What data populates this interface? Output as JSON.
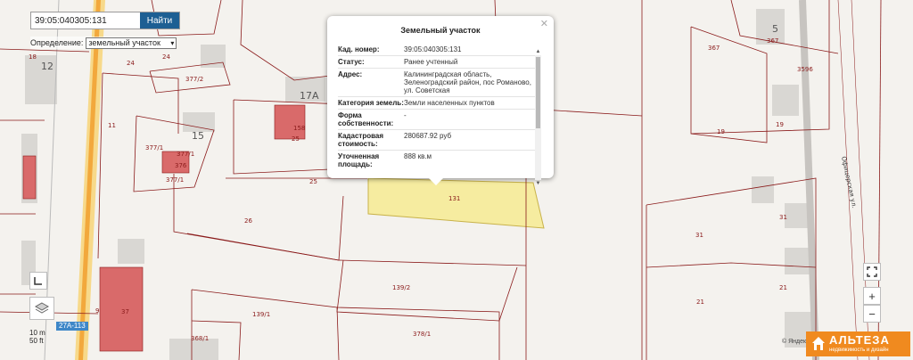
{
  "search": {
    "value": "39:05:040305:131",
    "button_label": "Найти"
  },
  "definition": {
    "label": "Определение:",
    "selected": "земельный участок"
  },
  "popup": {
    "title": "Земельный участок",
    "rows": [
      {
        "key": "Кад. номер:",
        "value": "39:05:040305:131"
      },
      {
        "key": "Статус:",
        "value": "Ранее учтенный"
      },
      {
        "key": "Адрес:",
        "value": "Калининградская область, Зеленоградский район, пос Романово, ул. Советская"
      },
      {
        "key": "Категория земель:",
        "value": "Земли населенных пунктов"
      },
      {
        "key": "Форма собственности:",
        "value": "-"
      },
      {
        "key": "Кадастровая стоимость:",
        "value": "280687.92 руб"
      },
      {
        "key": "Уточненная площадь:",
        "value": "888 кв.м"
      }
    ]
  },
  "map": {
    "parcel_labels": [
      "131",
      "24",
      "24",
      "11",
      "18",
      "12",
      "377/2",
      "17А",
      "158",
      "25",
      "25",
      "15",
      "377/1",
      "377/1",
      "377/1",
      "376",
      "26",
      "37",
      "9",
      "139/2",
      "139/1",
      "378/1",
      "368/1",
      "367",
      "367",
      "5",
      "3596",
      "19",
      "19",
      "31",
      "31",
      "21",
      "21"
    ],
    "street_label": "Офицерская ул.",
    "selected_parcel_color": "#f6eca0"
  },
  "controls": {
    "fullscreen": "fullscreen-icon",
    "zoom_in": "+",
    "zoom_out": "−"
  },
  "scale": {
    "line1": "10 m",
    "line2": "50 ft"
  },
  "route_badge": "27А-113",
  "attribution": "© Яндекс",
  "logo": {
    "title": "АЛЬТЕЗА",
    "subtitle": "недвижимость и дизайн"
  }
}
